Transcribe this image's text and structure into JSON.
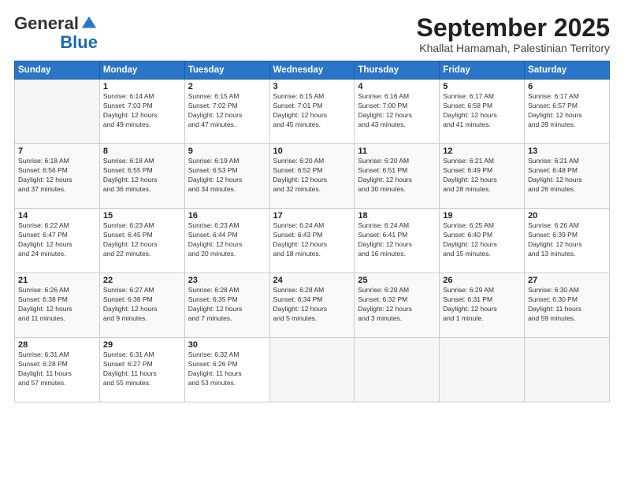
{
  "logo": {
    "general": "General",
    "blue": "Blue"
  },
  "title": "September 2025",
  "subtitle": "Khallat Hamamah, Palestinian Territory",
  "days_header": [
    "Sunday",
    "Monday",
    "Tuesday",
    "Wednesday",
    "Thursday",
    "Friday",
    "Saturday"
  ],
  "weeks": [
    [
      {
        "day": "",
        "info": ""
      },
      {
        "day": "1",
        "info": "Sunrise: 6:14 AM\nSunset: 7:03 PM\nDaylight: 12 hours\nand 49 minutes."
      },
      {
        "day": "2",
        "info": "Sunrise: 6:15 AM\nSunset: 7:02 PM\nDaylight: 12 hours\nand 47 minutes."
      },
      {
        "day": "3",
        "info": "Sunrise: 6:15 AM\nSunset: 7:01 PM\nDaylight: 12 hours\nand 45 minutes."
      },
      {
        "day": "4",
        "info": "Sunrise: 6:16 AM\nSunset: 7:00 PM\nDaylight: 12 hours\nand 43 minutes."
      },
      {
        "day": "5",
        "info": "Sunrise: 6:17 AM\nSunset: 6:58 PM\nDaylight: 12 hours\nand 41 minutes."
      },
      {
        "day": "6",
        "info": "Sunrise: 6:17 AM\nSunset: 6:57 PM\nDaylight: 12 hours\nand 39 minutes."
      }
    ],
    [
      {
        "day": "7",
        "info": "Sunrise: 6:18 AM\nSunset: 6:56 PM\nDaylight: 12 hours\nand 37 minutes."
      },
      {
        "day": "8",
        "info": "Sunrise: 6:18 AM\nSunset: 6:55 PM\nDaylight: 12 hours\nand 36 minutes."
      },
      {
        "day": "9",
        "info": "Sunrise: 6:19 AM\nSunset: 6:53 PM\nDaylight: 12 hours\nand 34 minutes."
      },
      {
        "day": "10",
        "info": "Sunrise: 6:20 AM\nSunset: 6:52 PM\nDaylight: 12 hours\nand 32 minutes."
      },
      {
        "day": "11",
        "info": "Sunrise: 6:20 AM\nSunset: 6:51 PM\nDaylight: 12 hours\nand 30 minutes."
      },
      {
        "day": "12",
        "info": "Sunrise: 6:21 AM\nSunset: 6:49 PM\nDaylight: 12 hours\nand 28 minutes."
      },
      {
        "day": "13",
        "info": "Sunrise: 6:21 AM\nSunset: 6:48 PM\nDaylight: 12 hours\nand 26 minutes."
      }
    ],
    [
      {
        "day": "14",
        "info": "Sunrise: 6:22 AM\nSunset: 6:47 PM\nDaylight: 12 hours\nand 24 minutes."
      },
      {
        "day": "15",
        "info": "Sunrise: 6:23 AM\nSunset: 6:45 PM\nDaylight: 12 hours\nand 22 minutes."
      },
      {
        "day": "16",
        "info": "Sunrise: 6:23 AM\nSunset: 6:44 PM\nDaylight: 12 hours\nand 20 minutes."
      },
      {
        "day": "17",
        "info": "Sunrise: 6:24 AM\nSunset: 6:43 PM\nDaylight: 12 hours\nand 18 minutes."
      },
      {
        "day": "18",
        "info": "Sunrise: 6:24 AM\nSunset: 6:41 PM\nDaylight: 12 hours\nand 16 minutes."
      },
      {
        "day": "19",
        "info": "Sunrise: 6:25 AM\nSunset: 6:40 PM\nDaylight: 12 hours\nand 15 minutes."
      },
      {
        "day": "20",
        "info": "Sunrise: 6:26 AM\nSunset: 6:39 PM\nDaylight: 12 hours\nand 13 minutes."
      }
    ],
    [
      {
        "day": "21",
        "info": "Sunrise: 6:26 AM\nSunset: 6:38 PM\nDaylight: 12 hours\nand 11 minutes."
      },
      {
        "day": "22",
        "info": "Sunrise: 6:27 AM\nSunset: 6:36 PM\nDaylight: 12 hours\nand 9 minutes."
      },
      {
        "day": "23",
        "info": "Sunrise: 6:28 AM\nSunset: 6:35 PM\nDaylight: 12 hours\nand 7 minutes."
      },
      {
        "day": "24",
        "info": "Sunrise: 6:28 AM\nSunset: 6:34 PM\nDaylight: 12 hours\nand 5 minutes."
      },
      {
        "day": "25",
        "info": "Sunrise: 6:29 AM\nSunset: 6:32 PM\nDaylight: 12 hours\nand 3 minutes."
      },
      {
        "day": "26",
        "info": "Sunrise: 6:29 AM\nSunset: 6:31 PM\nDaylight: 12 hours\nand 1 minute."
      },
      {
        "day": "27",
        "info": "Sunrise: 6:30 AM\nSunset: 6:30 PM\nDaylight: 11 hours\nand 59 minutes."
      }
    ],
    [
      {
        "day": "28",
        "info": "Sunrise: 6:31 AM\nSunset: 6:28 PM\nDaylight: 11 hours\nand 57 minutes."
      },
      {
        "day": "29",
        "info": "Sunrise: 6:31 AM\nSunset: 6:27 PM\nDaylight: 11 hours\nand 55 minutes."
      },
      {
        "day": "30",
        "info": "Sunrise: 6:32 AM\nSunset: 6:26 PM\nDaylight: 11 hours\nand 53 minutes."
      },
      {
        "day": "",
        "info": ""
      },
      {
        "day": "",
        "info": ""
      },
      {
        "day": "",
        "info": ""
      },
      {
        "day": "",
        "info": ""
      }
    ]
  ]
}
